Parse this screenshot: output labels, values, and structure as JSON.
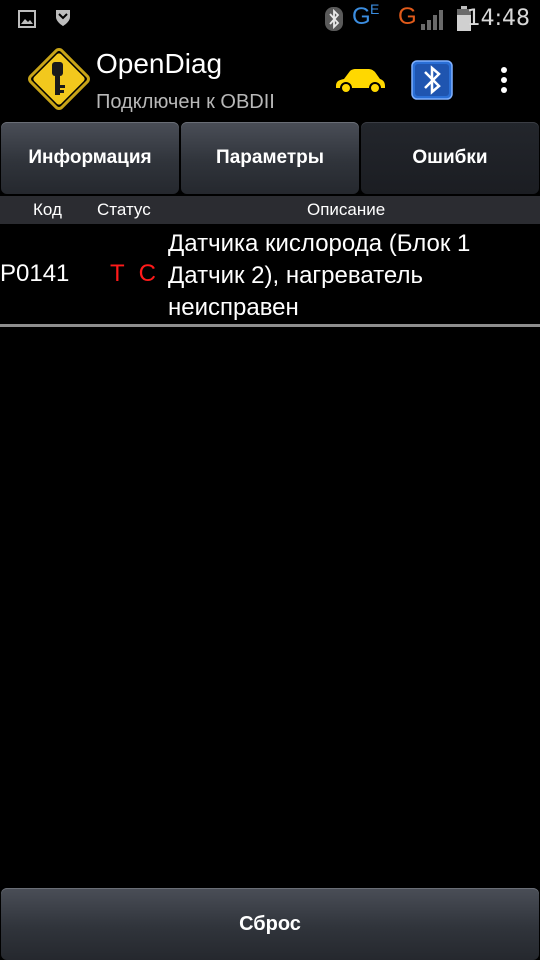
{
  "status_bar": {
    "time": "14:48",
    "network_label": "G",
    "network_sub": "E",
    "network_label_2": "G",
    "icons": [
      "gallery-icon",
      "shield-notification-icon",
      "bluetooth-icon",
      "signal-g-icon",
      "signal-bars-icon",
      "battery-icon"
    ]
  },
  "app_bar": {
    "title": "OpenDiag",
    "subtitle": "Подключен к OBDII",
    "icons": [
      "app-logo-key-icon",
      "car-icon",
      "bluetooth-adapter-icon",
      "overflow-menu-icon"
    ]
  },
  "tabs": [
    {
      "label": "Информация",
      "active": false
    },
    {
      "label": "Параметры",
      "active": false
    },
    {
      "label": "Ошибки",
      "active": true
    }
  ],
  "table": {
    "columns": [
      "Код",
      "Статус",
      "Описание"
    ],
    "rows": [
      {
        "code": "P0141",
        "status": [
          "Т",
          "С"
        ],
        "description": "Датчика кислорода (Блок 1 Датчик 2), нагреватель неисправен"
      }
    ]
  },
  "footer": {
    "reset_label": "Сброс"
  },
  "colors": {
    "background": "#000000",
    "status_red": "#ff1a1a",
    "header_bg": "#2b2c31",
    "logo_yellow": "#f2c81d",
    "car_yellow": "#ffd800",
    "bt_blue": "#2a6fd6",
    "network_blue": "#3b8de0",
    "network_orange": "#e05a1a"
  }
}
